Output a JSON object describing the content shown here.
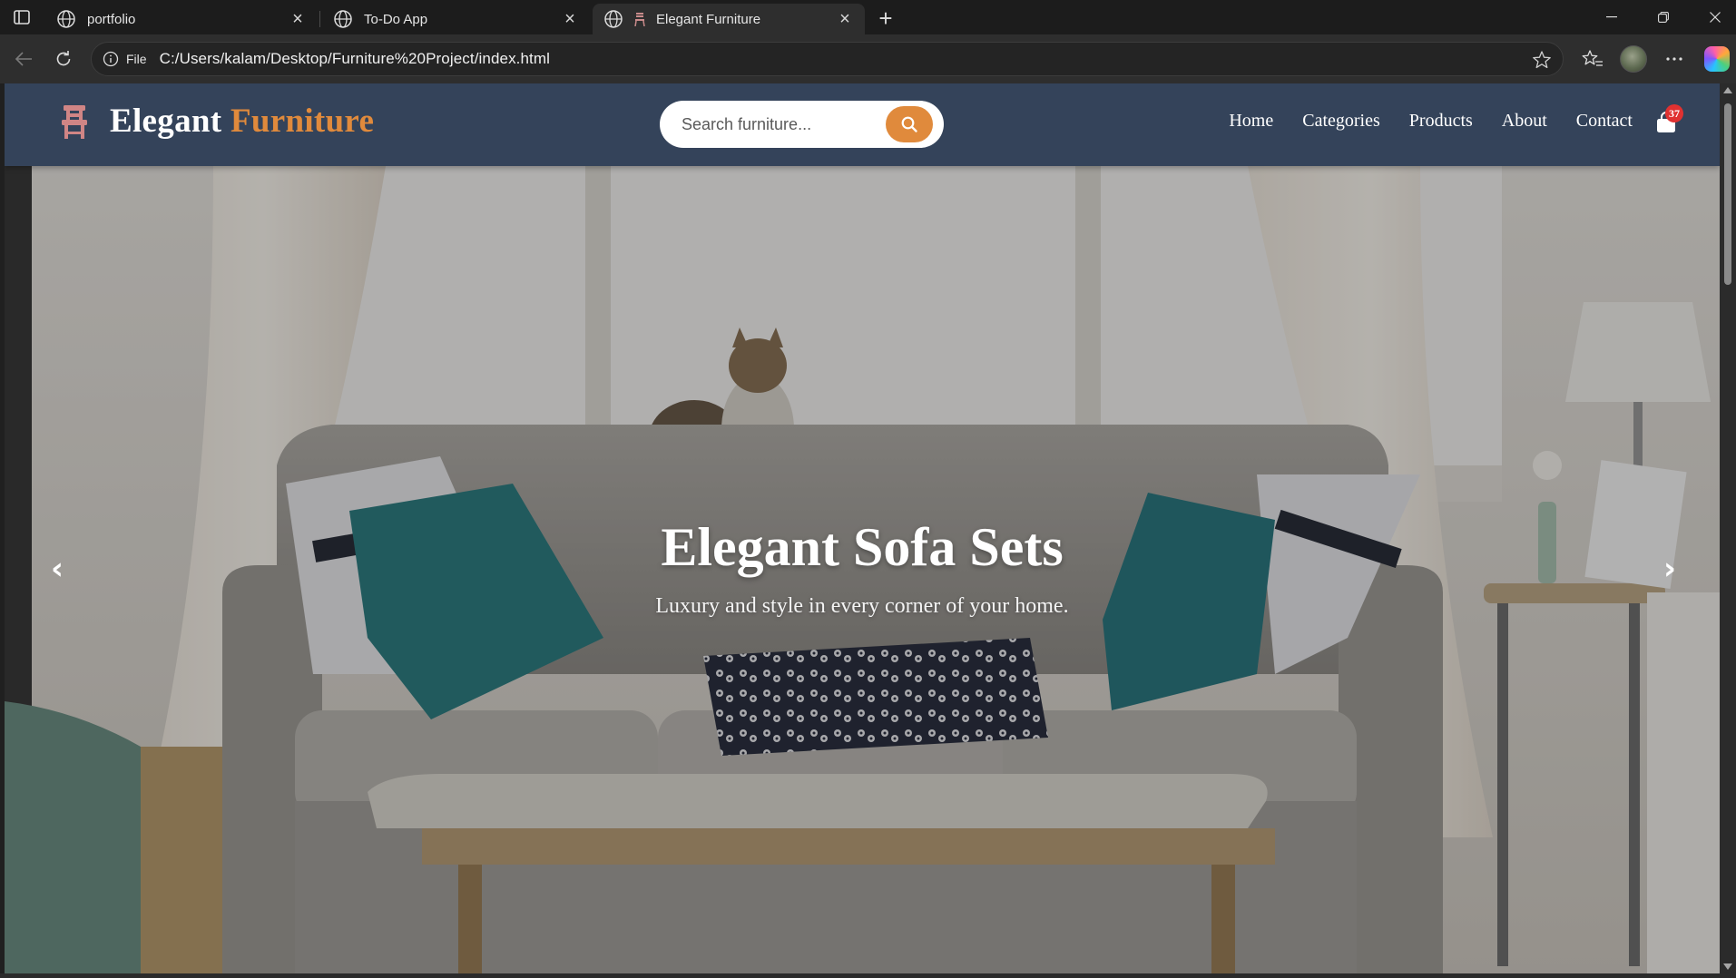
{
  "browser": {
    "tabs": [
      {
        "title": "portfolio",
        "active": false
      },
      {
        "title": "To-Do App",
        "active": false
      },
      {
        "title": "Elegant Furniture",
        "active": true
      }
    ],
    "address": {
      "chip_label": "File",
      "url": "C:/Users/kalam/Desktop/Furniture%20Project/index.html"
    }
  },
  "site": {
    "brand": {
      "part1": "Elegant",
      "part2": "Furniture"
    },
    "search": {
      "placeholder": "Search furniture..."
    },
    "nav": [
      "Home",
      "Categories",
      "Products",
      "About",
      "Contact"
    ],
    "cart_count": "37",
    "hero": {
      "title": "Elegant Sofa Sets",
      "subtitle": "Luxury and style in every corner of your home.",
      "prev_arrow": "‹",
      "next_arrow": "›"
    }
  },
  "colors": {
    "header_bg": "#34435a",
    "accent": "#e08a3c",
    "badge": "#e03131"
  },
  "icons": [
    "sidebar-toggle-icon",
    "globe-icon",
    "chair-icon",
    "close-icon",
    "new-tab-icon",
    "minimize-icon",
    "restore-icon",
    "window-close-icon",
    "back-icon",
    "refresh-icon",
    "info-icon",
    "star-icon",
    "favorites-icon",
    "more-icon",
    "copilot-icon",
    "search-icon",
    "cart-icon"
  ]
}
